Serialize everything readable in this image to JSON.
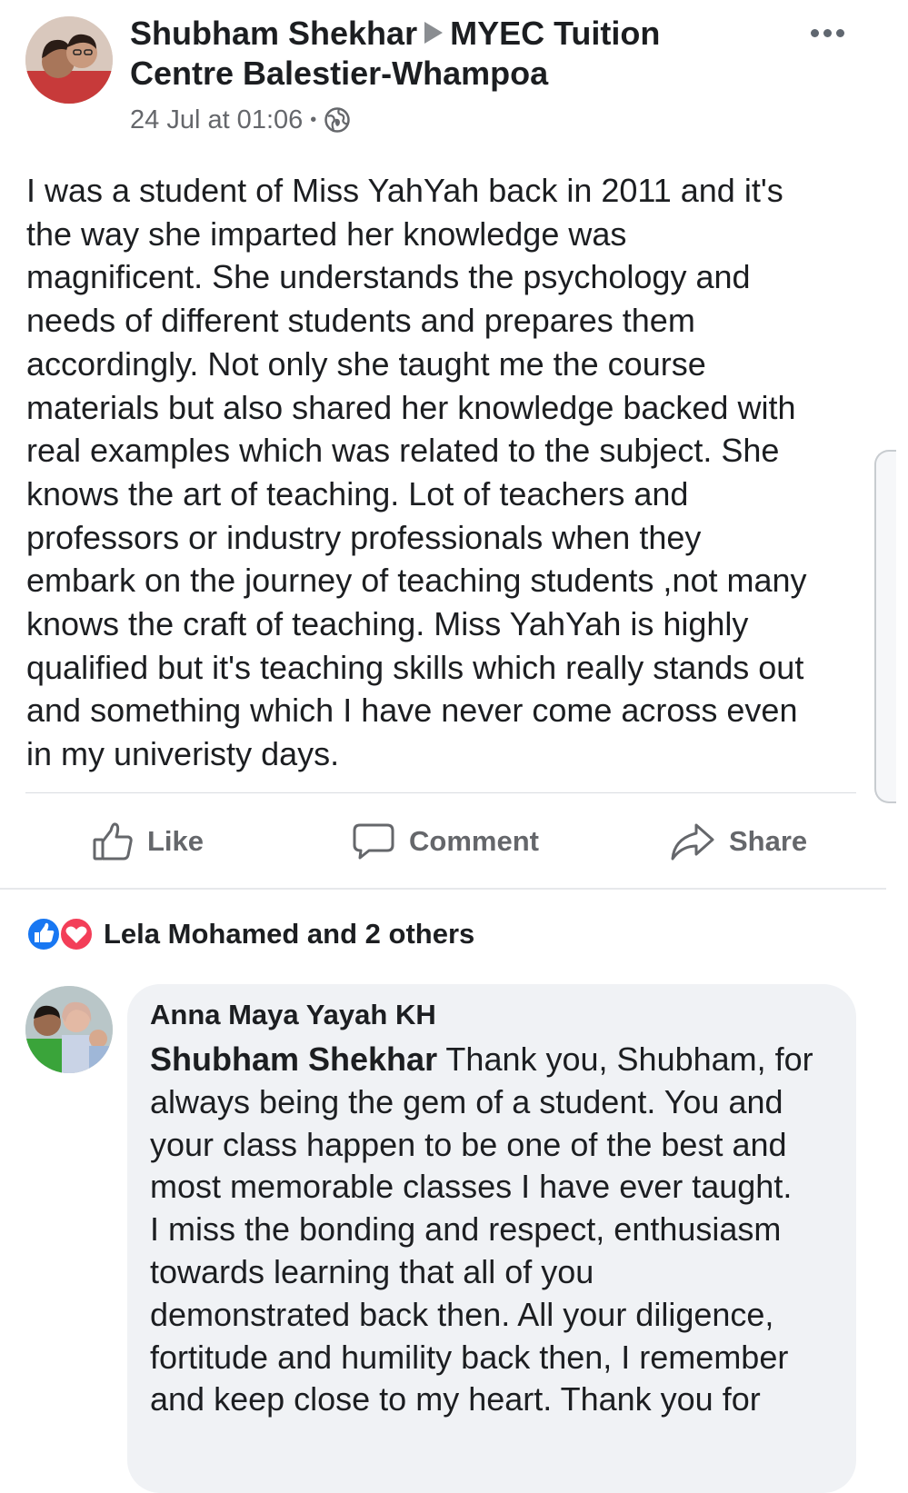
{
  "post": {
    "author": "Shubham Shekhar",
    "target": "MYEC Tuition Centre Balestier-Whampoa",
    "timestamp": "24 Jul at 01:06",
    "privacy_icon": "globe-icon",
    "body": "I was a student of Miss YahYah back in 2011 and it's\nthe  way she imparted her knowledge  was\nmagnificent. She understands the psychology and\nneeds of different  students and prepares them\naccordingly. Not only she taught me the course\nmaterials but also shared her knowledge backed with\nreal examples which was  related to the subject. She\nknows the art of teaching. Lot of teachers and\nprofessors or industry professionals when they\nembark on the journey of teaching students ,not many\nknows the craft of teaching. Miss YahYah is highly\nqualified but it's teaching skills which really stands out\nand something which I have never come across even\nin my univeristy days."
  },
  "actions": {
    "like_label": "Like",
    "comment_label": "Comment",
    "share_label": "Share"
  },
  "reactions": {
    "summary": "Lela Mohamed and 2 others",
    "like_color": "#1877f2",
    "love_color": "#f33e58"
  },
  "comment": {
    "author": "Anna Maya Yayah KH",
    "mention": "Shubham Shekhar",
    "text": " Thank you, Shubham, for\nalways being the gem of a student. You and\nyour class happen to be one of the best and\nmost memorable classes I have ever taught.\nI miss the bonding and respect, enthusiasm\ntowards learning that all of you\ndemonstrated back then. All your diligence,\nfortitude and humility back then, I remember\nand keep close to my heart. Thank you for"
  }
}
